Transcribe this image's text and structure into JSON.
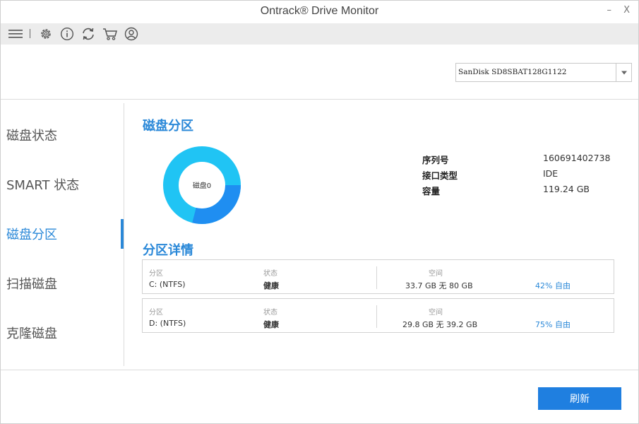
{
  "window": {
    "title": "Ontrack® Drive Monitor",
    "minimize_label": "–",
    "close_label": "X"
  },
  "toolbar": {
    "icons": [
      "menu-icon",
      "gear-icon",
      "info-icon",
      "refresh-icon",
      "cart-icon",
      "user-icon"
    ]
  },
  "disk_selector": {
    "selected": "SanDisk SD8SBAT128G1122"
  },
  "sidebar": {
    "items": [
      {
        "label": "磁盘状态",
        "active": false
      },
      {
        "label": "SMART 状态",
        "active": false
      },
      {
        "label": "磁盘分区",
        "active": true
      },
      {
        "label": "扫描磁盘",
        "active": false
      },
      {
        "label": "克隆磁盘",
        "active": false
      }
    ]
  },
  "disk_partition": {
    "title": "磁盘分区",
    "donut_label": "磁盘0",
    "donut_colors": {
      "free": "#20c4f4",
      "used": "#1f8ef1"
    },
    "donut_used_fraction": 0.29,
    "info": [
      {
        "label": "序列号",
        "value": "160691402738"
      },
      {
        "label": "接口类型",
        "value": "IDE"
      },
      {
        "label": "容量",
        "value": "119.24 GB"
      }
    ]
  },
  "partition_details": {
    "title": "分区详情",
    "headers": {
      "partition": "分区",
      "status": "状态",
      "space": "空间"
    },
    "rows": [
      {
        "partition": "C: (NTFS)",
        "status": "健康",
        "space": "33.7 GB 无 80 GB",
        "free": "42% 自由"
      },
      {
        "partition": "D: (NTFS)",
        "status": "健康",
        "space": "29.8 GB 无 39.2 GB",
        "free": "75% 自由"
      }
    ]
  },
  "footer": {
    "refresh_label": "刷新"
  },
  "colors": {
    "accent": "#2a88d8",
    "button": "#1f7fe0",
    "toolbar_bg": "#ececec"
  }
}
